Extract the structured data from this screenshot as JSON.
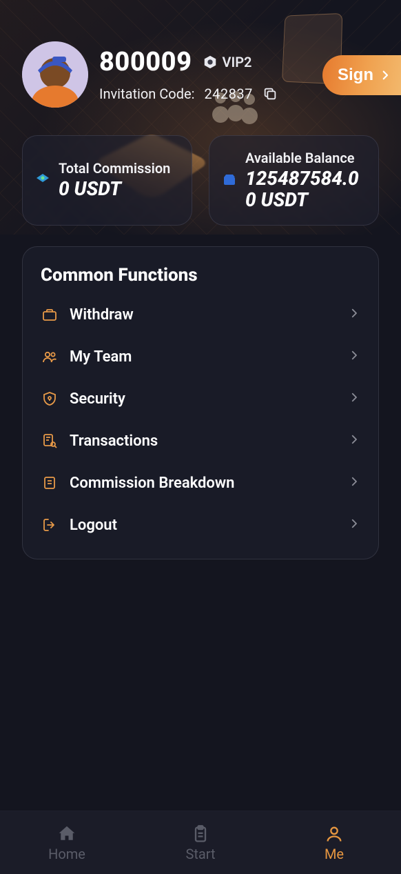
{
  "hero": {
    "uid": "800009",
    "vip_label": "VIP2",
    "invitation_label": "Invitation Code:",
    "invitation_code": "242837",
    "sign_label": "Sign"
  },
  "stats": {
    "commission": {
      "label": "Total Commission",
      "value": "0 USDT"
    },
    "balance": {
      "label": "Available Balance",
      "value": "125487584.00 USDT"
    }
  },
  "functions": {
    "title": "Common Functions",
    "items": [
      {
        "label": "Withdraw"
      },
      {
        "label": "My Team"
      },
      {
        "label": "Security"
      },
      {
        "label": "Transactions"
      },
      {
        "label": "Commission Breakdown"
      },
      {
        "label": "Logout"
      }
    ]
  },
  "tabs": {
    "home": "Home",
    "start": "Start",
    "me": "Me"
  }
}
